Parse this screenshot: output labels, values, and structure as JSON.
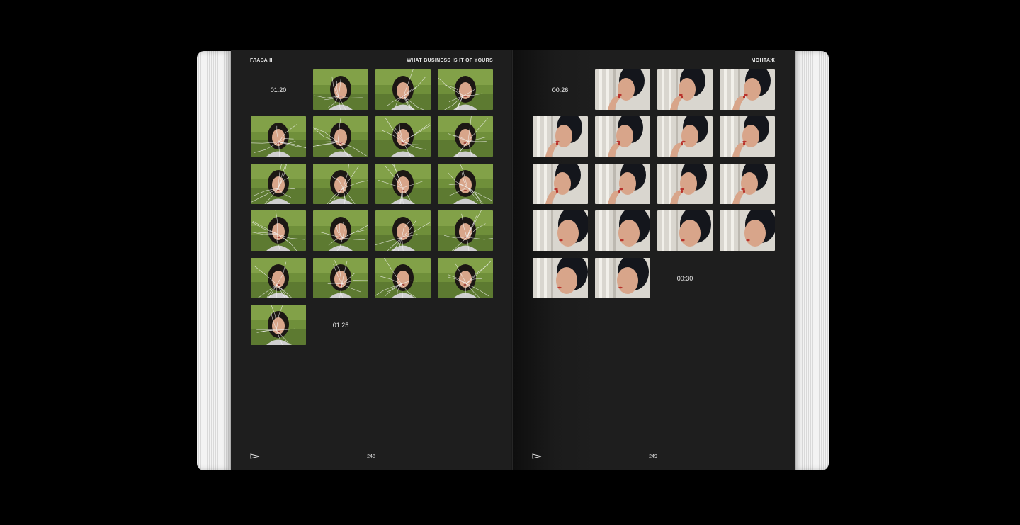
{
  "left_page": {
    "chapter": "ГЛАВА II",
    "running_title": "WHAT BUSINESS IS IT OF YOURS",
    "timecode_start": "01:20",
    "timecode_end": "01:25",
    "page_number": "248",
    "frame_rows": [
      3,
      4,
      4,
      4,
      4,
      1
    ]
  },
  "right_page": {
    "running_title": "МОНТАЖ",
    "timecode_start": "00:26",
    "timecode_end": "00:30",
    "page_number": "249",
    "frame_rows": [
      3,
      4,
      4,
      4,
      2
    ]
  },
  "icons": {
    "folio_mark": "triangle-arrow-icon",
    "left_frames": "shattered-glass-portrait-frame",
    "right_frames": "window-portrait-frame"
  },
  "colors": {
    "page": "#1e1e1e",
    "background": "#000000",
    "text": "#e6e6e6",
    "foliage": "#6f8f3a",
    "skin": "#d8a58a",
    "lips": "#b8322c"
  }
}
